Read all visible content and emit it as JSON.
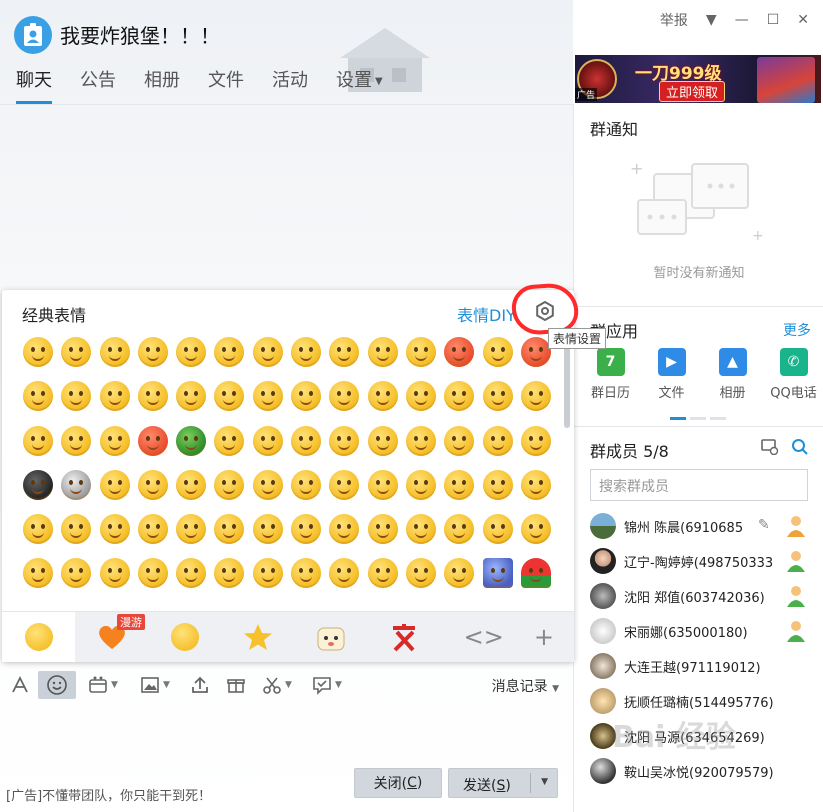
{
  "header": {
    "group_title": "我要炸狼堡！！！",
    "report": "举报"
  },
  "tabs": [
    {
      "label": "聊天",
      "active": true
    },
    {
      "label": "公告"
    },
    {
      "label": "相册"
    },
    {
      "label": "文件"
    },
    {
      "label": "活动"
    },
    {
      "label": "设置"
    }
  ],
  "ad_banner": {
    "tag": "广告",
    "main_text": "一刀999级",
    "cta": "立即领取"
  },
  "emoji_panel": {
    "title": "经典表情",
    "diy_link": "表情DIY",
    "gear_tooltip": "表情设置",
    "tab_badge": "漫游",
    "accent": "#1e8fd8",
    "annotation_color": "#ff2b2b"
  },
  "toolbar": {
    "message_record": "消息记录"
  },
  "footer": {
    "ad_text": "[广告]不懂带团队，你只能干到死！",
    "close_label": "关闭(",
    "close_key": "C",
    "close_end": ")",
    "send_label": "发送(",
    "send_key": "S",
    "send_end": ")"
  },
  "right_panel": {
    "notice_title": "群通知",
    "notice_empty": "暂时没有新通知",
    "apps_title": "群应用",
    "more": "更多",
    "apps": [
      {
        "label": "群日历",
        "icon": "calendar-icon",
        "color": "#3bb04a"
      },
      {
        "label": "文件",
        "icon": "folder-icon",
        "color": "#2e8ce6"
      },
      {
        "label": "相册",
        "icon": "photo-icon",
        "color": "#2e8ce6"
      },
      {
        "label": "QQ电话",
        "icon": "phone-icon",
        "color": "#19b38c"
      }
    ],
    "members_title": "群成员 5/8",
    "search_placeholder": "搜索群成员",
    "members": [
      {
        "name": "锦州 陈晨(6910685"
      },
      {
        "name": "辽宁-陶婷婷(498750333)"
      },
      {
        "name": "沈阳 郑值(603742036)"
      },
      {
        "name": "宋丽娜(635000180)"
      },
      {
        "name": "大连王越(971119012)"
      },
      {
        "name": "抚顺任璐楠(514495776)"
      },
      {
        "name": "沈阳 马源(634654269)"
      },
      {
        "name": "鞍山吴冰悦(920079579)"
      }
    ]
  },
  "watermark": "Bai 经验"
}
